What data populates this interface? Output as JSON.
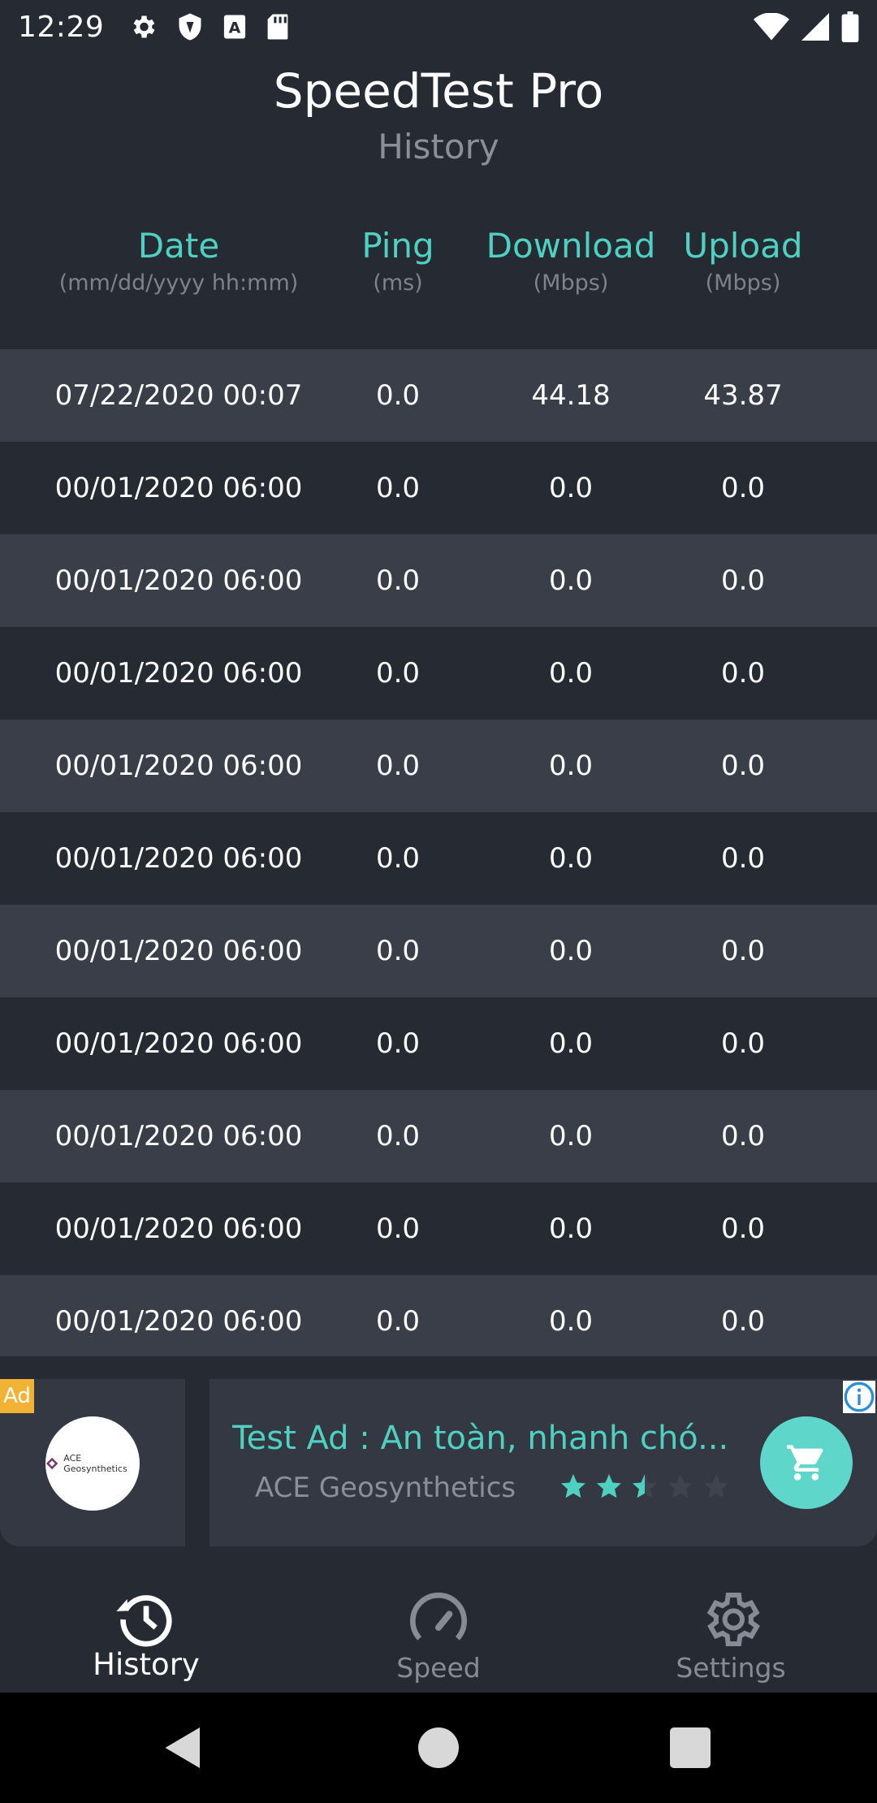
{
  "status_bar": {
    "time": "12:29",
    "left_icons": [
      "gear-icon",
      "shield-icon",
      "font-a-icon",
      "sd-card-icon"
    ],
    "right_icons": [
      "wifi-icon",
      "signal-icon",
      "battery-icon"
    ]
  },
  "header": {
    "title": "SpeedTest Pro",
    "subtitle": "History"
  },
  "columns": {
    "date": {
      "label": "Date",
      "unit": "(mm/dd/yyyy hh:mm)"
    },
    "ping": {
      "label": "Ping",
      "unit": "(ms)"
    },
    "download": {
      "label": "Download",
      "unit": "(Mbps)"
    },
    "upload": {
      "label": "Upload",
      "unit": "(Mbps)"
    }
  },
  "rows": [
    {
      "date": "07/22/2020 00:07",
      "ping": "0.0",
      "download": "44.18",
      "upload": "43.87"
    },
    {
      "date": "00/01/2020 06:00",
      "ping": "0.0",
      "download": "0.0",
      "upload": "0.0"
    },
    {
      "date": "00/01/2020 06:00",
      "ping": "0.0",
      "download": "0.0",
      "upload": "0.0"
    },
    {
      "date": "00/01/2020 06:00",
      "ping": "0.0",
      "download": "0.0",
      "upload": "0.0"
    },
    {
      "date": "00/01/2020 06:00",
      "ping": "0.0",
      "download": "0.0",
      "upload": "0.0"
    },
    {
      "date": "00/01/2020 06:00",
      "ping": "0.0",
      "download": "0.0",
      "upload": "0.0"
    },
    {
      "date": "00/01/2020 06:00",
      "ping": "0.0",
      "download": "0.0",
      "upload": "0.0"
    },
    {
      "date": "00/01/2020 06:00",
      "ping": "0.0",
      "download": "0.0",
      "upload": "0.0"
    },
    {
      "date": "00/01/2020 06:00",
      "ping": "0.0",
      "download": "0.0",
      "upload": "0.0"
    },
    {
      "date": "00/01/2020 06:00",
      "ping": "0.0",
      "download": "0.0",
      "upload": "0.0"
    },
    {
      "date": "00/01/2020 06:00",
      "ping": "0.0",
      "download": "0.0",
      "upload": "0.0"
    }
  ],
  "ad": {
    "badge": "Ad",
    "logo_text": "ACE Geosynthetics",
    "headline": "Test Ad : An toàn, nhanh chó...",
    "advertiser": "ACE Geosynthetics",
    "rating": 2.5,
    "rating_max": 5,
    "cta_icon": "shopping-cart-icon",
    "info_icon": "info-icon"
  },
  "bottom_nav": {
    "items": [
      {
        "label": "History",
        "icon": "history-icon",
        "active": true
      },
      {
        "label": "Speed",
        "icon": "speedometer-icon",
        "active": false
      },
      {
        "label": "Settings",
        "icon": "gear-icon",
        "active": false
      }
    ]
  },
  "colors": {
    "background": "#262a33",
    "row_alt": "#3a3e48",
    "accent": "#4fd1c1",
    "muted": "#8a8f99"
  }
}
